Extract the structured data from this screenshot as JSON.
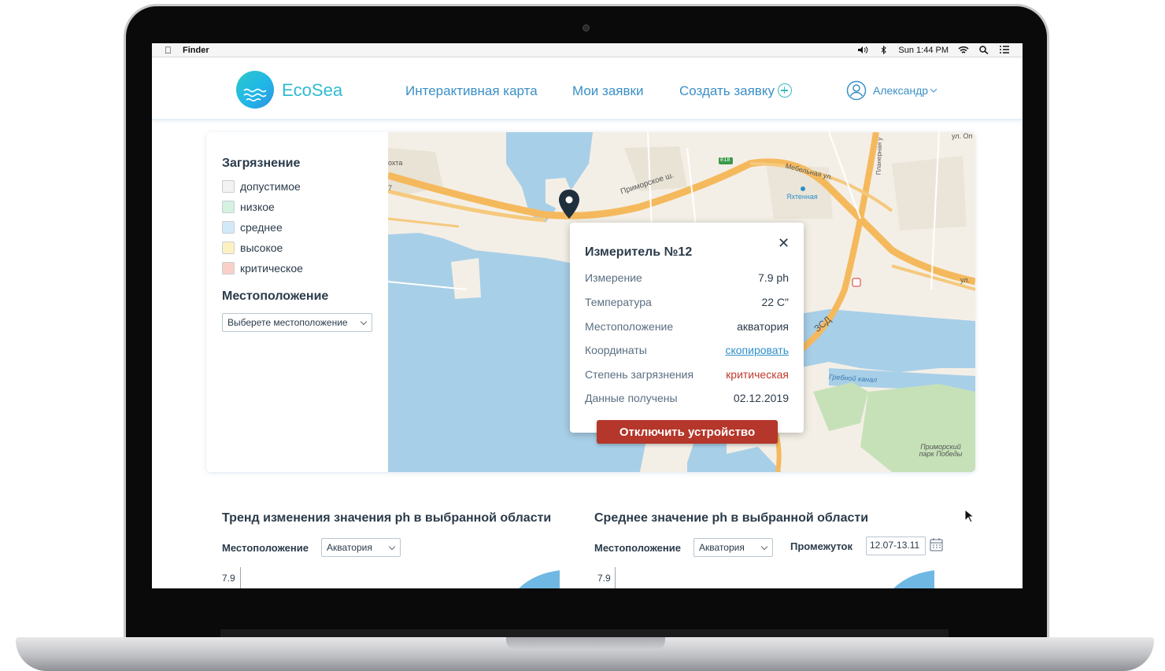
{
  "menubar": {
    "app": "Finder",
    "clock": "Sun 1:44 PM"
  },
  "header": {
    "logo_text": "EcoSea",
    "nav": {
      "map": "Интерактивная карта",
      "my_requests": "Мои заявки",
      "create_request": "Создать заявку"
    },
    "user_name": "Александр"
  },
  "filters": {
    "pollution_title": "Загрязнение",
    "levels": [
      {
        "label": "допустимое",
        "color": "#f2f2f2"
      },
      {
        "label": "низкое",
        "color": "#d5f1e0"
      },
      {
        "label": "среднее",
        "color": "#d3e9fa"
      },
      {
        "label": "высокое",
        "color": "#fdf1c3"
      },
      {
        "label": "критическое",
        "color": "#f8d0c8"
      }
    ],
    "location_title": "Местоположение",
    "location_placeholder": "Выберете местоположение"
  },
  "map": {
    "labels": {
      "road": "Приморское ш.",
      "street1": "Мебельная ул.",
      "station": "Яхтенная",
      "highway": "ЗСД",
      "canal": "Гребной канал",
      "park": "Приморский парк Победы",
      "e18": "E18",
      "street_right": "ул.",
      "street_top": "ул. Оп",
      "street_vert": "Планерная у",
      "left_edge1": "охта",
      "left_edge2": "7"
    }
  },
  "popup": {
    "title": "Измеритель №12",
    "rows": [
      {
        "key": "Измерение",
        "value": "7.9 ph"
      },
      {
        "key": "Температура",
        "value": "22 С\""
      },
      {
        "key": "Местоположение",
        "value": "акватория"
      },
      {
        "key": "Координаты",
        "value": "скопировать"
      },
      {
        "key": "Степень загрязнения",
        "value": "критическая"
      },
      {
        "key": "Данные получены",
        "value": "02.12.2019"
      }
    ],
    "disable_button": "Отключить устройство"
  },
  "charts": {
    "trend": {
      "title": "Тренд изменения значения ph в выбранной области",
      "location_label": "Местоположение",
      "location_value": "Акватория",
      "y_tick": "7.9"
    },
    "average": {
      "title": "Среднее значение ph в выбранной области",
      "location_label": "Местоположение",
      "location_value": "Акватория",
      "period_label": "Промежуток",
      "period_value": "12.07-13.11",
      "y_tick": "7.9"
    }
  },
  "colors": {
    "accent": "#3a8fc7",
    "critical": "#b5362a",
    "water": "#a8cfe8"
  }
}
